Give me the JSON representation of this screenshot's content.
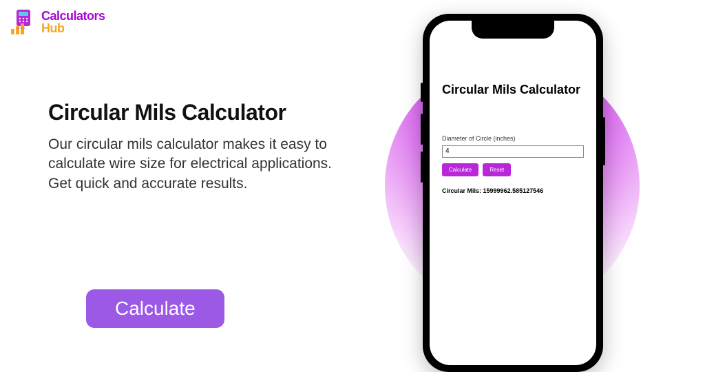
{
  "logo": {
    "line1": "Calculators",
    "line2": "Hub"
  },
  "hero": {
    "title": "Circular Mils Calculator",
    "description": "Our circular mils calculator makes it easy to calculate wire size for electrical applications. Get quick and accurate results.",
    "button": "Calculate"
  },
  "phone": {
    "title": "Circular Mils Calculator",
    "field_label": "Diameter of Circle (inches)",
    "field_value": "4",
    "calculate_btn": "Calculate",
    "reset_btn": "Reset",
    "result_label": "Circular Mils:",
    "result_value": "15999962.585127546"
  }
}
